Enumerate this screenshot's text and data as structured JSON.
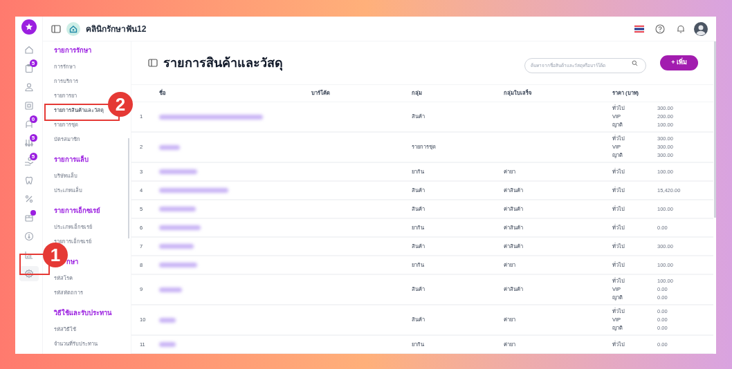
{
  "header": {
    "clinic_name": "คลินิกรักษาฟัน12"
  },
  "rail": [
    {
      "selected": false
    },
    {
      "badge": "5",
      "selected": false
    },
    {
      "selected": false
    },
    {
      "selected": false
    },
    {
      "badge": "0",
      "selected": false
    },
    {
      "badge": "5",
      "selected": false
    },
    {
      "badge": "5",
      "selected": false
    },
    {
      "selected": false
    },
    {
      "selected": false
    },
    {
      "dot": true,
      "selected": false
    },
    {
      "selected": false
    },
    {
      "selected": false
    },
    {
      "selected": true
    }
  ],
  "menu": [
    {
      "heading": "รายการรักษา",
      "items": [
        {
          "label": "การรักษา",
          "selected": false
        },
        {
          "label": "การบริการ",
          "selected": false
        },
        {
          "label": "รายการยา",
          "selected": false
        },
        {
          "label": "รายการสินค้าและวัสดุ",
          "selected": true
        },
        {
          "label": "รายการชุด",
          "selected": false
        },
        {
          "label": "บัตรสมาชิก",
          "selected": false
        }
      ]
    },
    {
      "heading": "รายการแล็บ",
      "items": [
        {
          "label": "บริษัทแล็บ",
          "selected": false
        },
        {
          "label": "ประเภทแล็บ",
          "selected": false
        }
      ]
    },
    {
      "heading": "รายการเอ็กซเรย์",
      "items": [
        {
          "label": "ประเภทเอ็กซเรย์",
          "selected": false
        },
        {
          "label": "รายการเอ็กซเรย์",
          "selected": false
        }
      ]
    },
    {
      "heading": "กษา",
      "items": [
        {
          "label": "รหัสโรค",
          "selected": false
        },
        {
          "label": "รหัสหัตถการ",
          "selected": false
        }
      ]
    },
    {
      "heading": "วิธีใช้และรับประทาน",
      "items": [
        {
          "label": "รหัสวิธีใช้",
          "selected": false
        },
        {
          "label": "จำนวนที่รับประทาน",
          "selected": false
        }
      ]
    }
  ],
  "page": {
    "title": "รายการสินค้าและวัสดุ",
    "search_placeholder": "ค้นหาจากชื่อสินค้าและวัสดุหรือบาร์โค้ด",
    "add_button": "+ เพิ่ม"
  },
  "table": {
    "columns": [
      "ชื่อ",
      "บาร์โค้ด",
      "กลุ่ม",
      "กลุ่มใบเสร็จ",
      "ราคา (บาท)"
    ],
    "rows": [
      {
        "no": "1",
        "group": "สินค้า",
        "prices": [
          [
            "ทั่วไป",
            "300.00"
          ],
          [
            "VIP",
            "200.00"
          ],
          [
            "ญาติ",
            "100.00"
          ]
        ]
      },
      {
        "no": "2",
        "group": "รายการชุด",
        "prices": [
          [
            "ทั่วไป",
            "300.00"
          ],
          [
            "VIP",
            "300.00"
          ],
          [
            "ญาติ",
            "300.00"
          ]
        ]
      },
      {
        "no": "3",
        "group": "ยากิน",
        "receipt_group": "ค่ายา",
        "prices": [
          [
            "ทั่วไป",
            "100.00"
          ]
        ]
      },
      {
        "no": "4",
        "group": "สินค้า",
        "receipt_group": "ค่าสินค้า",
        "prices": [
          [
            "ทั่วไป",
            "15,420.00"
          ]
        ]
      },
      {
        "no": "5",
        "group": "สินค้า",
        "receipt_group": "ค่าสินค้า",
        "prices": [
          [
            "ทั่วไป",
            "100.00"
          ]
        ]
      },
      {
        "no": "6",
        "group": "ยากิน",
        "receipt_group": "ค่าสินค้า",
        "prices": [
          [
            "ทั่วไป",
            "0.00"
          ]
        ]
      },
      {
        "no": "7",
        "group": "สินค้า",
        "receipt_group": "ค่าสินค้า",
        "prices": [
          [
            "ทั่วไป",
            "300.00"
          ]
        ]
      },
      {
        "no": "8",
        "group": "ยากิน",
        "receipt_group": "ค่ายา",
        "prices": [
          [
            "ทั่วไป",
            "100.00"
          ]
        ]
      },
      {
        "no": "9",
        "group": "สินค้า",
        "receipt_group": "ค่าสินค้า",
        "prices": [
          [
            "ทั่วไป",
            "100.00"
          ],
          [
            "VIP",
            "0.00"
          ],
          [
            "ญาติ",
            "0.00"
          ]
        ]
      },
      {
        "no": "10",
        "group": "สินค้า",
        "receipt_group": "ค่ายา",
        "prices": [
          [
            "ทั่วไป",
            "0.00"
          ],
          [
            "VIP",
            "0.00"
          ],
          [
            "ญาติ",
            "0.00"
          ]
        ]
      },
      {
        "no": "11",
        "group": "ยากิน",
        "receipt_group": "ค่ายา",
        "prices": [
          [
            "ทั่วไป",
            "0.00"
          ]
        ]
      }
    ]
  },
  "annotations": [
    {
      "label": "1"
    },
    {
      "label": "2"
    }
  ]
}
